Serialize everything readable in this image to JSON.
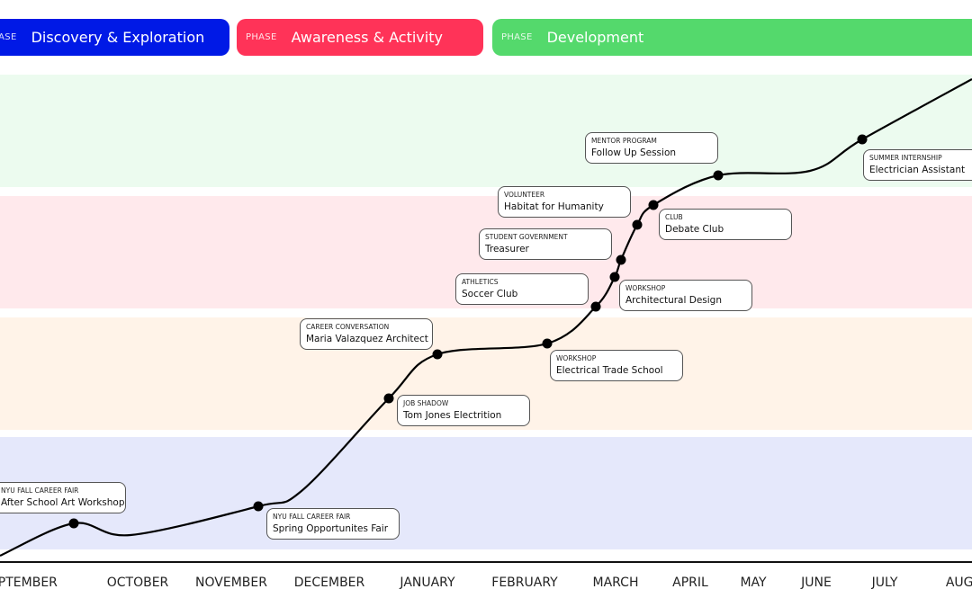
{
  "phases": [
    {
      "tag": "PHASE",
      "title": "Discovery & Exploration",
      "color": "#0019e6"
    },
    {
      "tag": "PHASE",
      "title": "Awareness & Activity",
      "color": "#ff3358"
    },
    {
      "tag": "PHASE",
      "title": "Development",
      "color": "#54d96c"
    }
  ],
  "bands": [
    "#ecfbef",
    "#ffe9ec",
    "#fff3e8",
    "#e5e8fb"
  ],
  "events": [
    {
      "category": "NYU Fall Career Fair",
      "title": "After School Art Workshop"
    },
    {
      "category": "NYU Fall Career Fair",
      "title": "Spring Opportunites Fair"
    },
    {
      "category": "Job Shadow",
      "title": "Tom Jones Electrition"
    },
    {
      "category": "Career Conversation",
      "title": "Maria Valazquez Architect"
    },
    {
      "category": "Workshop",
      "title": "Electrical Trade School"
    },
    {
      "category": "Athletics",
      "title": "Soccer Club"
    },
    {
      "category": "Workshop",
      "title": "Architectural Design"
    },
    {
      "category": "Student Government",
      "title": "Treasurer"
    },
    {
      "category": "Club",
      "title": "Debate Club"
    },
    {
      "category": "Volunteer",
      "title": "Habitat for Humanity"
    },
    {
      "category": "Mentor Program",
      "title": "Follow Up Session"
    },
    {
      "category": "Summer Internship",
      "title": "Electrician Assistant"
    }
  ],
  "months": [
    "SEPTEMBER",
    "OCTOBER",
    "NOVEMBER",
    "DECEMBER",
    "JANUARY",
    "FEBRUARY",
    "MARCH",
    "APRIL",
    "MAY",
    "JUNE",
    "JULY",
    "AUGUST"
  ]
}
